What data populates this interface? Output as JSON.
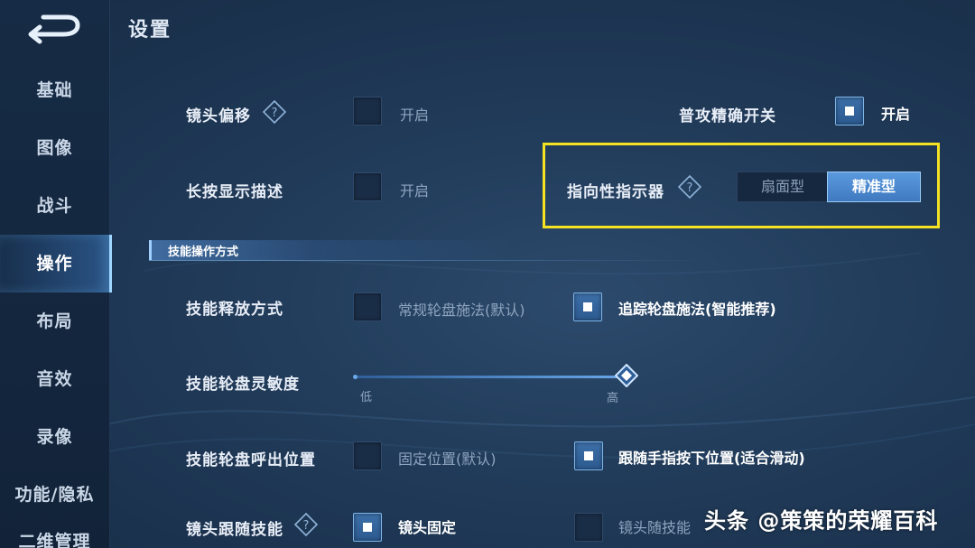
{
  "header": {
    "title": "设置"
  },
  "sidebar": {
    "items": [
      {
        "label": "基础"
      },
      {
        "label": "图像"
      },
      {
        "label": "战斗"
      },
      {
        "label": "操作",
        "active": true
      },
      {
        "label": "布局"
      },
      {
        "label": "音效"
      },
      {
        "label": "录像"
      },
      {
        "label": "功能/隐私"
      },
      {
        "label": "二维管理"
      }
    ]
  },
  "settings": {
    "camera_offset": {
      "label": "镜头偏移",
      "option": "开启",
      "checked": false
    },
    "long_press_desc": {
      "label": "长按显示描述",
      "option": "开启",
      "checked": false
    },
    "precise_attack": {
      "label": "普攻精确开关",
      "option": "开启",
      "checked": true
    },
    "directional_indicator": {
      "label": "指向性指示器",
      "options": [
        "扇面型",
        "精准型"
      ],
      "selected": "精准型"
    },
    "skill_section": {
      "title": "技能操作方式"
    },
    "skill_cast": {
      "label": "技能释放方式",
      "option_a": "常规轮盘施法(默认)",
      "option_b": "追踪轮盘施法(智能推荐)",
      "selected": "option_b"
    },
    "wheel_sensitivity": {
      "label": "技能轮盘灵敏度",
      "min_label": "低",
      "max_label": "高",
      "value": 1.0
    },
    "wheel_position": {
      "label": "技能轮盘呼出位置",
      "option_a": "固定位置(默认)",
      "option_b": "跟随手指按下位置(适合滑动)",
      "selected": "option_b"
    },
    "camera_follow": {
      "label": "镜头跟随技能",
      "option_a": "镜头固定",
      "option_b": "镜头随技能",
      "selected": "option_a"
    }
  },
  "watermark": {
    "text": "头条 @策策的荣耀百科"
  },
  "colors": {
    "highlight": "#f5e223",
    "accent": "#5b9ae0",
    "background": "#203a58"
  }
}
